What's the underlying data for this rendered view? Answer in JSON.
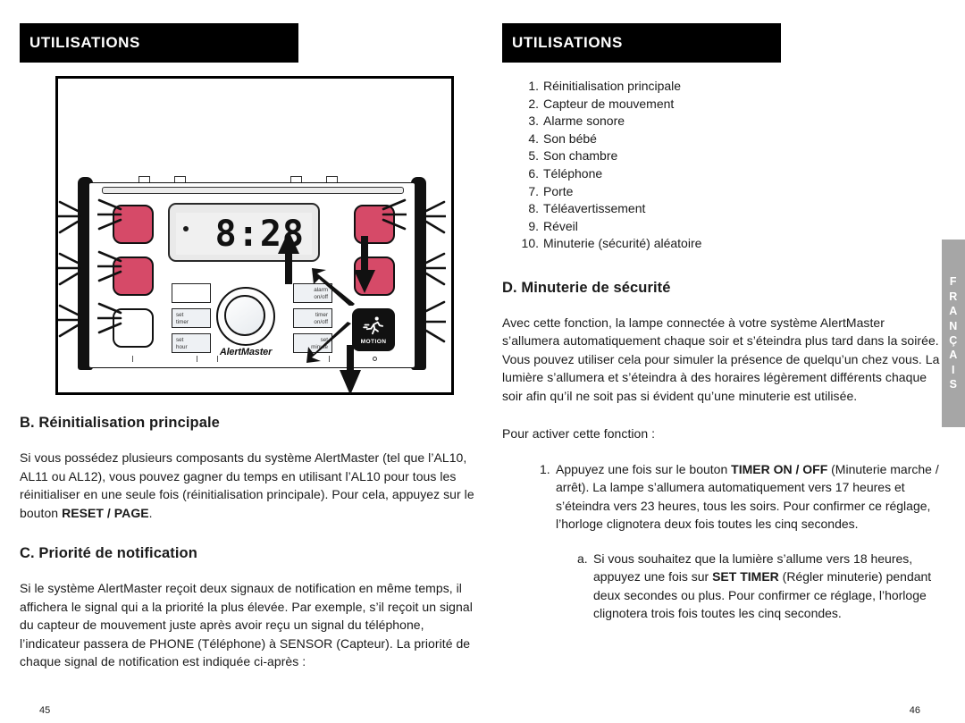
{
  "left_page": {
    "banner": "UTILISATIONS",
    "page_number": "45",
    "figure": {
      "brand": "AlertMaster",
      "display_time": "8:28",
      "keys": {
        "blank": "",
        "set_timer": "set\ntimer",
        "set_hour": "set\nhour",
        "alarm_onoff": "alarm\non/off",
        "timer_onoff": "timer\non/off",
        "set_minute": "set\nminute"
      },
      "motion_label": "MOTION"
    },
    "section_b": {
      "heading": "B. Réinitialisation principale",
      "paragraph_1": "Si vous possédez plusieurs composants du système AlertMaster (tel que l’AL10, AL11 ou AL12), vous pouvez gagner du temps en utilisant l’AL10 pour tous les réinitialiser en une seule fois (réinitialisation principale). Pour cela, appuyez sur le bouton ",
      "paragraph_1_bold": "RESET / PAGE",
      "paragraph_1_end": "."
    },
    "section_c": {
      "heading": "C. Priorité de notification",
      "paragraph_1": "Si le système AlertMaster reçoit deux signaux de notification en même temps, il affichera le signal qui a la priorité la plus élevée. Par exemple, s’il reçoit un signal du capteur de mouvement juste après avoir reçu un signal du téléphone, l’indicateur passera de PHONE (Téléphone) à SENSOR (Capteur). La priorité de chaque signal de notification est indiquée ci-après :"
    }
  },
  "right_page": {
    "banner": "UTILISATIONS",
    "page_number": "46",
    "priority_list": [
      {
        "num": "1.",
        "label": "Réinitialisation principale"
      },
      {
        "num": "2.",
        "label": "Capteur de mouvement"
      },
      {
        "num": "3.",
        "label": "Alarme sonore"
      },
      {
        "num": "4.",
        "label": "Son bébé"
      },
      {
        "num": "5.",
        "label": "Son chambre"
      },
      {
        "num": "6.",
        "label": "Téléphone"
      },
      {
        "num": "7.",
        "label": "Porte"
      },
      {
        "num": "8.",
        "label": "Téléavertissement"
      },
      {
        "num": "9.",
        "label": "Réveil"
      },
      {
        "num": "10.",
        "label": "Minuterie (sécurité) aléatoire"
      }
    ],
    "section_d": {
      "heading": "D. Minuterie de sécurité",
      "paragraph_1": "Avec cette fonction, la lampe connectée à votre système AlertMaster s’allumera automatiquement chaque soir et s’éteindra plus tard dans la soirée. Vous pouvez utiliser cela pour simuler la présence de quelqu’un chez vous. La lumière s’allumera et s’éteindra à des horaires légèrement différents chaque soir afin qu’il ne soit pas si évident qu’une minuterie est utilisée.",
      "intro": "Pour activer cette fonction :",
      "step_1": {
        "num": "1.",
        "text_before": "Appuyez une fois sur le bouton ",
        "bold": "TIMER ON / OFF",
        "text_after": " (Minuterie marche / arrêt). La lampe s’allumera automatiquement vers 17 heures et s’éteindra vers 23 heures, tous les soirs. Pour confirmer ce réglage, l’horloge clignotera deux fois toutes les cinq secondes."
      },
      "substep_a": {
        "num": "a.",
        "text_before": "Si vous souhaitez que la lumière s’allume vers 18 heures, appuyez une fois sur ",
        "bold": "SET TIMER",
        "text_after": " (Régler minuterie) pendant deux secondes ou plus. Pour confirmer ce réglage, l’horloge clignotera trois fois toutes les cinq secondes."
      }
    }
  },
  "language_tab": {
    "letters": [
      "F",
      "R",
      "A",
      "N",
      "Ç",
      "A",
      "I",
      "S"
    ],
    "color": "#a6a6a6"
  }
}
